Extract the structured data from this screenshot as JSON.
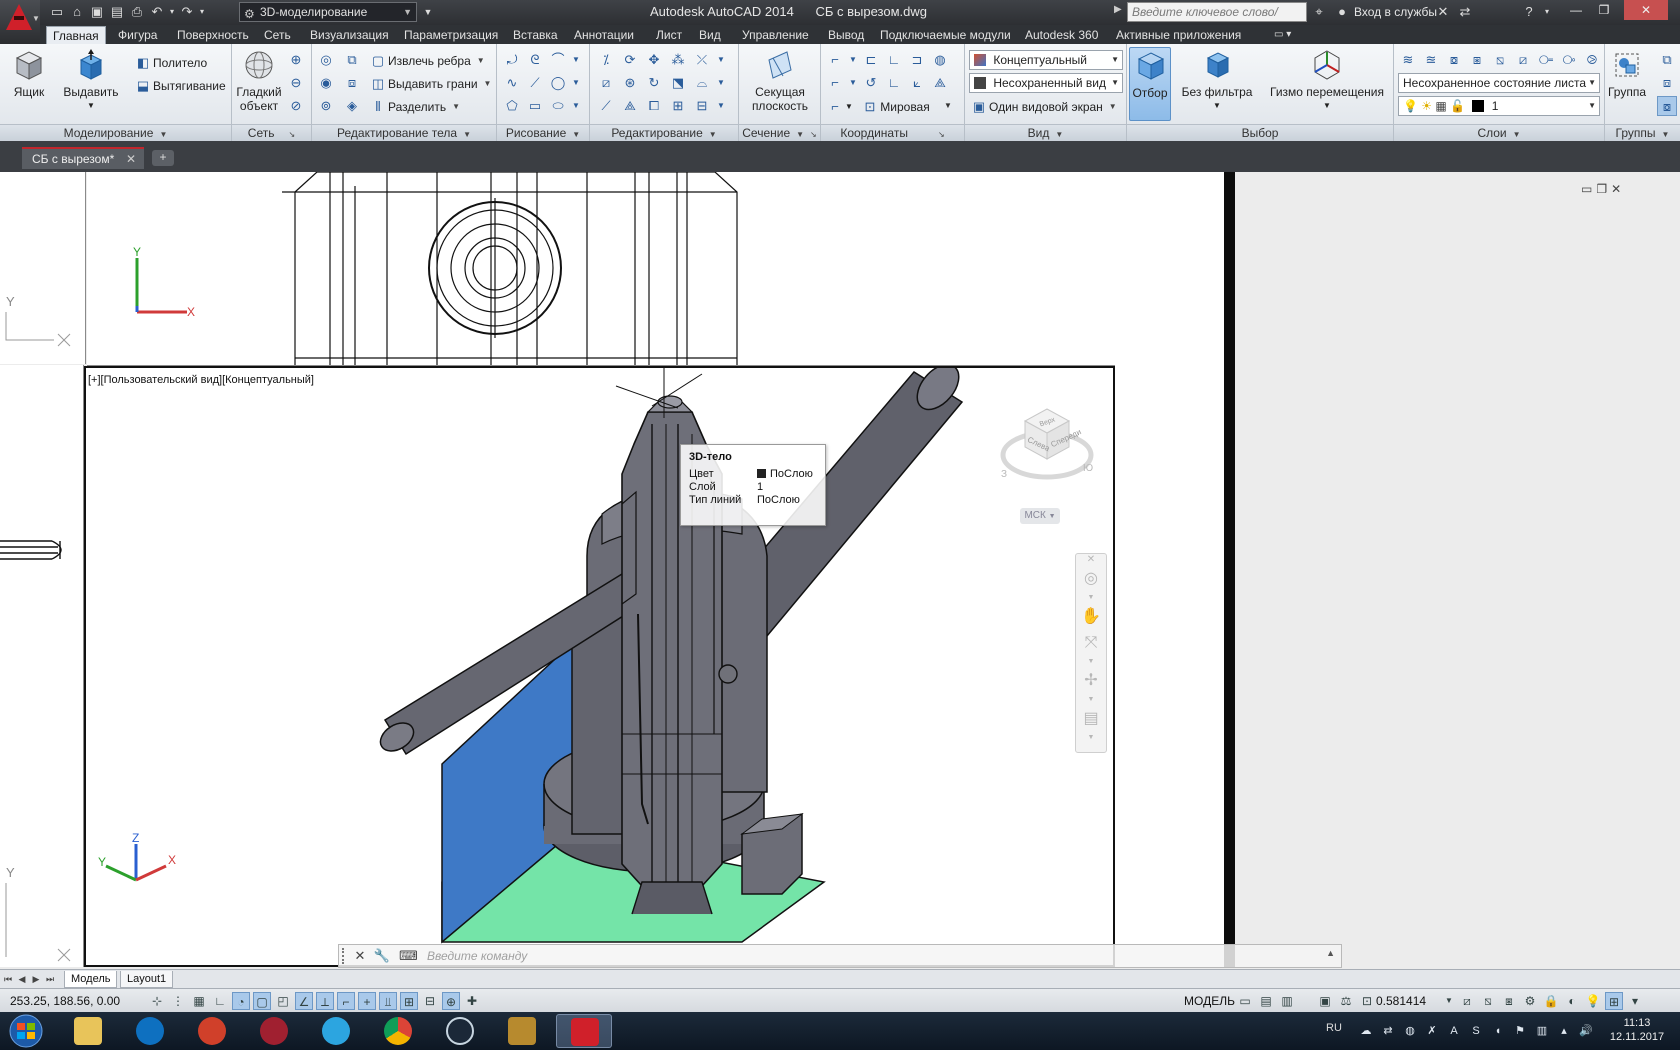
{
  "titlebar": {
    "workspace": "3D-моделирование",
    "app_name": "Autodesk AutoCAD 2014",
    "file_name": "СБ с вырезом.dwg",
    "search_placeholder": "Введите ключевое слово/фразу",
    "signin_label": "Вход в службы"
  },
  "ribbon_tabs": [
    "Главная",
    "Фигура",
    "Поверхность",
    "Сеть",
    "Визуализация",
    "Параметризация",
    "Вставка",
    "Аннотации",
    "Лист",
    "Вид",
    "Управление",
    "Вывод",
    "Подключаемые модули",
    "Autodesk 360",
    "Активные приложения"
  ],
  "panels": {
    "modeling": {
      "title": "Моделирование",
      "box_label": "Ящик",
      "extrude_label": "Выдавить",
      "polysolid_label": "Политело",
      "presspull_label": "Вытягивание"
    },
    "mesh": {
      "title": "Сеть",
      "smooth_label": "Гладкий объект"
    },
    "solid_edit": {
      "title": "Редактирование тела",
      "extract_edges": "Извлечь ребра",
      "extrude_faces": "Выдавить грани",
      "separate": "Разделить"
    },
    "draw": {
      "title": "Рисование"
    },
    "modify": {
      "title": "Редактирование"
    },
    "section": {
      "title": "Сечение",
      "plane_label": "Секущая плоскость"
    },
    "coordinates": {
      "title": "Координаты",
      "ucs_world": "Мировая"
    },
    "view": {
      "title": "Вид",
      "visual_style": "Концептуальный",
      "named_view": "Несохраненный вид",
      "viewport_config": "Один видовой экран"
    },
    "selection": {
      "title": "Выбор",
      "culling_label": "Отбор",
      "filter_label": "Без фильтра",
      "gizmo_label": "Гизмо перемещения"
    },
    "layers": {
      "title": "Слои",
      "layer_state": "Несохраненное состояние листа",
      "current_layer": "1"
    },
    "groups": {
      "title": "Группы",
      "group_label": "Группа"
    }
  },
  "document_tab": "СБ с вырезом*",
  "viewport_label": "[+][Пользовательский вид][Концептуальный]",
  "tooltip": {
    "title": "3D-тело",
    "rows": [
      {
        "key": "Цвет",
        "value": "ПоСлою"
      },
      {
        "key": "Слой",
        "value": "1"
      },
      {
        "key": "Тип линий",
        "value": "ПоСлою"
      }
    ]
  },
  "viewcube": {
    "top_face": "Верх",
    "front_face": "Слева",
    "right_face": "Спереди",
    "compass": [
      "З",
      "Ю"
    ],
    "ucs_label": "МСК"
  },
  "axis_labels": {
    "x": "X",
    "y": "Y",
    "z": "Z"
  },
  "command_line": {
    "placeholder": "Введите команду"
  },
  "layout_tabs": [
    "Модель",
    "Layout1"
  ],
  "status": {
    "coords": "253.25, 188.56, 0.00",
    "space": "МОДЕЛЬ",
    "scale": "0.581414"
  },
  "taskbar": {
    "lang": "RU",
    "time": "11:13",
    "date": "12.11.2017"
  },
  "colors": {
    "title_bg": "#2d2f33",
    "ribbon_bg": "#e9edf2",
    "model_body": "#6a6b75",
    "blue_plate": "#3e79c6",
    "green_plate": "#74e4a8",
    "autocad_red": "#d0202a"
  }
}
